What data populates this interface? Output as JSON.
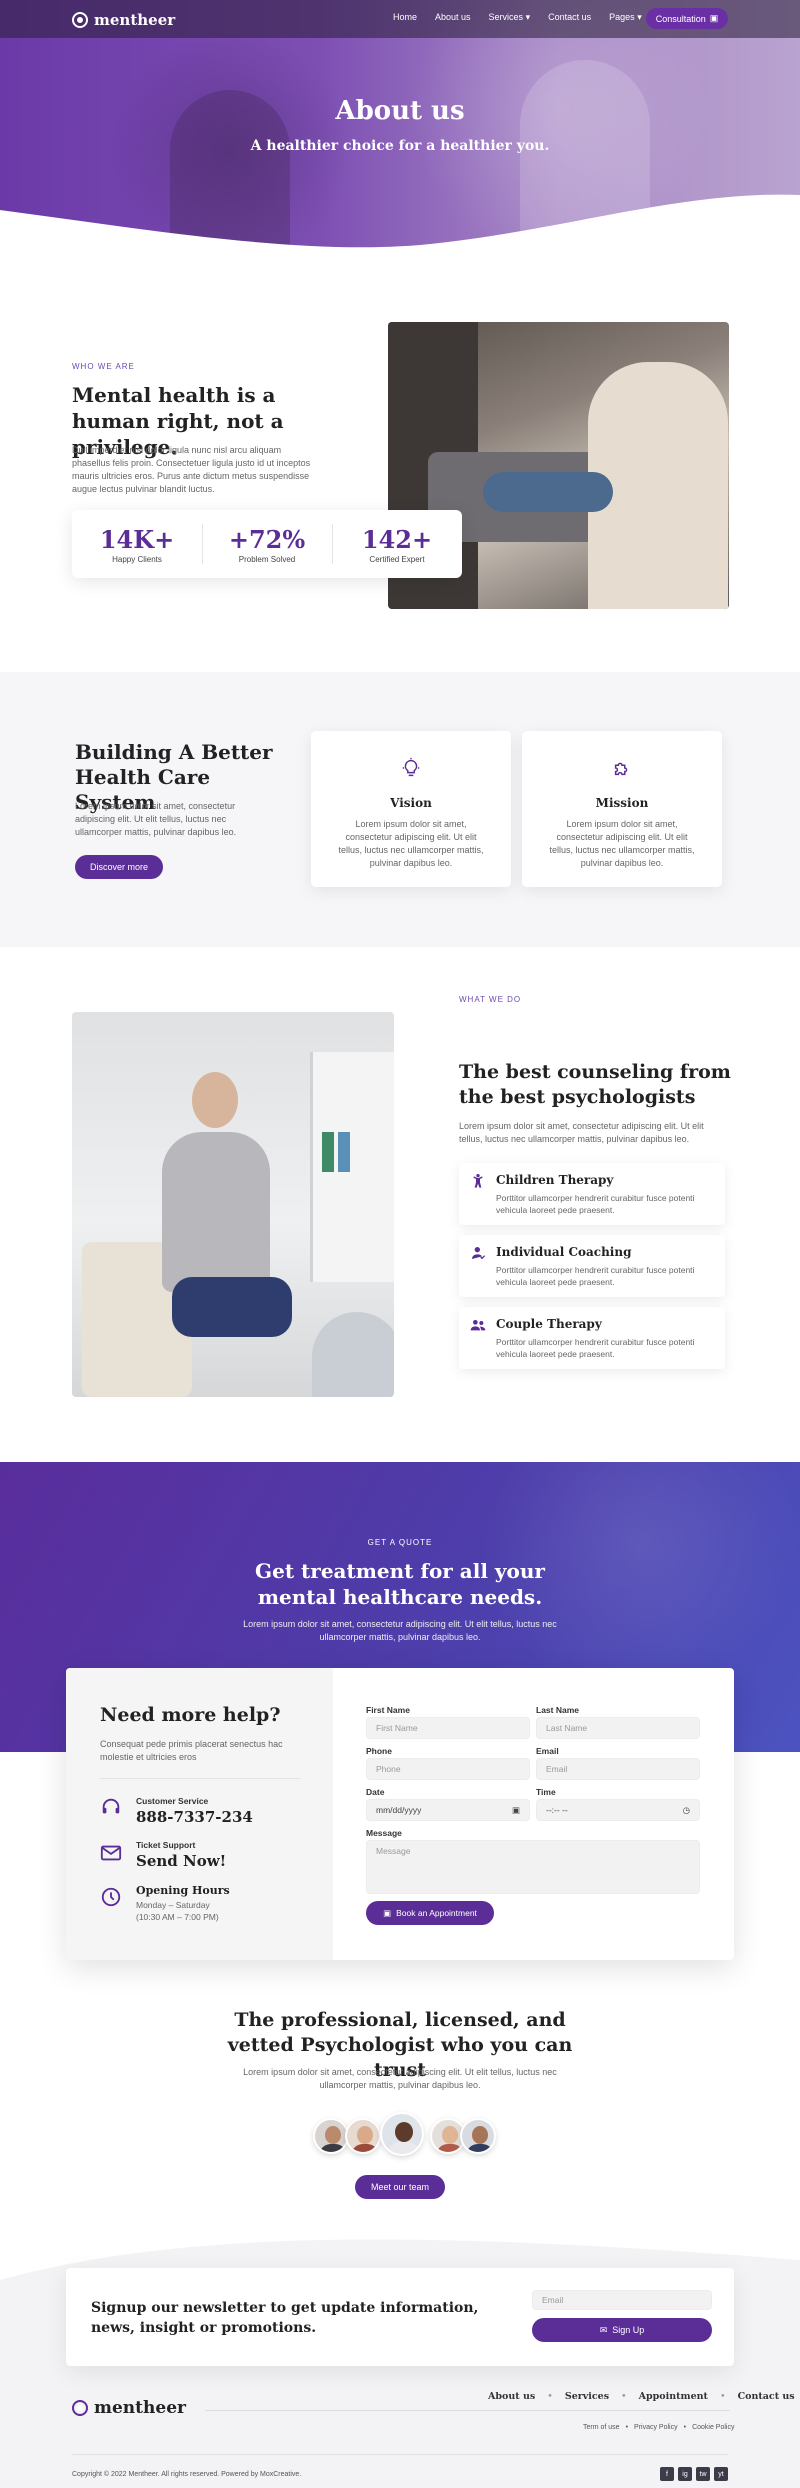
{
  "header": {
    "brand": "mentheer",
    "nav": [
      "Home",
      "About us",
      "Services",
      "Contact us",
      "Pages"
    ],
    "cta": "Consultation"
  },
  "hero": {
    "title": "About us",
    "subtitle": "A healthier choice for a healthier you."
  },
  "about": {
    "eyebrow": "WHO WE ARE",
    "title": "Mental health is a human right, not a privilege.",
    "body": "Duil imperdiet nisl dolor ligula nunc nisl arcu aliquam phasellus felis proin. Consectetuer ligula justo id ut inceptos mauris ultricies eros. Purus ante dictum metus suspendisse augue lectus pulvinar blandit luctus.",
    "stats": [
      {
        "value": "14K+",
        "label": "Happy Clients"
      },
      {
        "value": "+72%",
        "label": "Problem Solved"
      },
      {
        "value": "142+",
        "label": "Certified Expert"
      }
    ]
  },
  "building": {
    "title": "Building A Better Health Care System",
    "body": "Lorem ipsum dolor sit amet, consectetur adipiscing elit. Ut elit tellus, luctus nec ullamcorper mattis, pulvinar dapibus leo.",
    "button": "Discover more",
    "cards": [
      {
        "title": "Vision",
        "icon": "lightbulb-icon",
        "body": "Lorem ipsum dolor sit amet, consectetur adipiscing elit. Ut elit tellus, luctus nec ullamcorper mattis, pulvinar dapibus leo."
      },
      {
        "title": "Mission",
        "icon": "puzzle-icon",
        "body": "Lorem ipsum dolor sit amet, consectetur adipiscing elit. Ut elit tellus, luctus nec ullamcorper mattis, pulvinar dapibus leo."
      }
    ]
  },
  "services": {
    "eyebrow": "WHAT WE DO",
    "title": "The best counseling from the best psychologists",
    "body": "Lorem ipsum dolor sit amet, consectetur adipiscing elit. Ut elit tellus, luctus nec ullamcorper mattis, pulvinar dapibus leo.",
    "items": [
      {
        "title": "Children Therapy",
        "icon": "child-icon",
        "body": "Porttitor ullamcorper hendrerit curabitur fusce potenti vehicula laoreet pede praesent."
      },
      {
        "title": "Individual Coaching",
        "icon": "user-icon",
        "body": "Porttitor ullamcorper hendrerit curabitur fusce potenti vehicula laoreet pede praesent."
      },
      {
        "title": "Couple Therapy",
        "icon": "users-icon",
        "body": "Porttitor ullamcorper hendrerit curabitur fusce potenti vehicula laoreet pede praesent."
      }
    ]
  },
  "quote": {
    "eyebrow": "GET A QUOTE",
    "title": "Get treatment for all your mental healthcare needs.",
    "body": "Lorem ipsum dolor sit amet, consectetur adipiscing elit. Ut elit tellus, luctus nec ullamcorper mattis, pulvinar dapibus leo."
  },
  "help": {
    "title": "Need more help?",
    "body": "Consequat pede primis placerat senectus hac molestie et ultricies eros",
    "contacts": [
      {
        "label": "Customer Service",
        "value": "888-7337-234",
        "icon": "headset-icon"
      },
      {
        "label": "Ticket Support",
        "value": "Send Now!",
        "icon": "envelope-icon"
      },
      {
        "label": "Opening Hours",
        "line1": "Monday – Saturday",
        "line2": "(10:30 AM – 7:00 PM)",
        "icon": "clock-icon"
      }
    ]
  },
  "form": {
    "first_name": {
      "label": "First Name",
      "placeholder": "First Name"
    },
    "last_name": {
      "label": "Last Name",
      "placeholder": "Last Name"
    },
    "phone": {
      "label": "Phone",
      "placeholder": "Phone"
    },
    "email": {
      "label": "Email",
      "placeholder": "Email"
    },
    "date": {
      "label": "Date",
      "placeholder": "mm/dd/yyyy"
    },
    "time": {
      "label": "Time",
      "placeholder": "--:-- --"
    },
    "message": {
      "label": "Message",
      "placeholder": "Message"
    },
    "submit": "Book an Appointment"
  },
  "team": {
    "title": "The professional, licensed, and vetted Psychologist who you can trust",
    "body": "Lorem ipsum dolor sit amet, consectetur adipiscing elit. Ut elit tellus, luctus nec ullamcorper mattis, pulvinar dapibus leo.",
    "button": "Meet our team"
  },
  "newsletter": {
    "title": "Signup our newsletter to get update information, news, insight or promotions.",
    "email_placeholder": "Email",
    "button": "Sign Up"
  },
  "footer": {
    "brand": "mentheer",
    "links": [
      "About us",
      "Services",
      "Appointment",
      "Contact us"
    ],
    "legal": [
      "Term of use",
      "Privacy Policy",
      "Cookie Policy"
    ],
    "copyright": "Copyright © 2022 Mentheer. All rights reserved. Powered by MoxCreative.",
    "social": [
      "f",
      "ig",
      "tw",
      "yt"
    ]
  },
  "colors": {
    "primary": "#5b2d97",
    "accent": "#6b4bb0"
  }
}
